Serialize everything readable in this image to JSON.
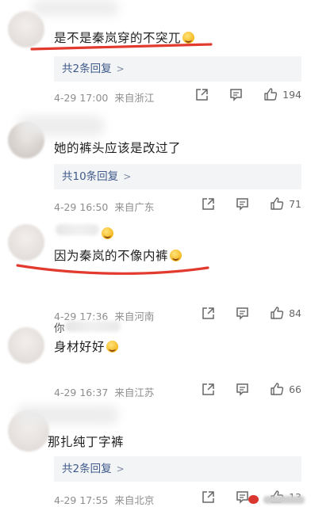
{
  "comments": [
    {
      "text": "是不是秦岚穿的不突兀",
      "reply": "共2条回复",
      "date": "4-29 17:00",
      "location": "来自浙江",
      "likes": "194"
    },
    {
      "text": "她的裤头应该是改过了",
      "reply": "共10条回复",
      "date": "4-29 16:50",
      "location": "来自广东",
      "likes": "71"
    },
    {
      "text": "因为秦岚的不像内裤",
      "reply": "",
      "date": "4-29 17:36",
      "location": "来自河南",
      "likes": "84"
    },
    {
      "username_prefix": "你",
      "text": "身材好好",
      "reply": "",
      "date": "4-29 16:37",
      "location": "来自江苏",
      "likes": "66"
    },
    {
      "text": "那扎纯丁字裤",
      "reply": "共2条回复",
      "date": "4-29 17:55",
      "location": "来自北京",
      "likes": "13"
    }
  ],
  "reply_chevron": ">",
  "icons": {
    "share": "share-icon",
    "comment": "comment-icon",
    "like": "thumbs-up-icon"
  },
  "colors": {
    "underline": "#e23a2e",
    "reply_text": "#3f5a8a",
    "meta": "#8e8e8e"
  }
}
